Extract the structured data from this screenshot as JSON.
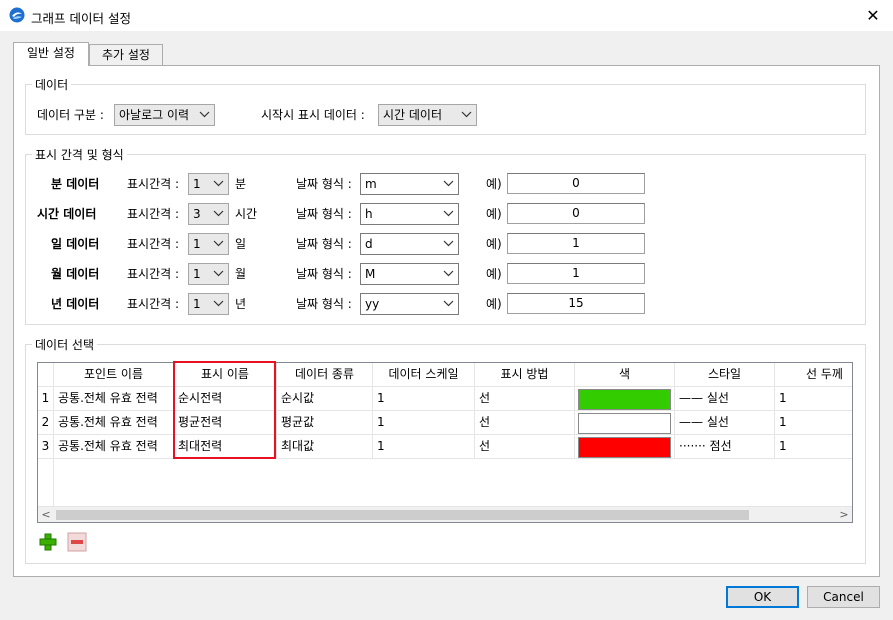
{
  "window": {
    "title": "그래프 데이터 설정",
    "close_glyph": "✕"
  },
  "tabs": [
    {
      "label": "일반 설정"
    },
    {
      "label": "추가 설정"
    }
  ],
  "data_group": {
    "title": "데이터",
    "type_label": "데이터 구분 :",
    "type_value": "아날로그 이력",
    "startup_label": "시작시 표시 데이터 :",
    "startup_value": "시간 데이터"
  },
  "interval_group": {
    "title": "표시 간격 및 형식",
    "interval_label": "표시간격 :",
    "date_format_label": "날짜 형식 :",
    "example_label": "예)",
    "rows": [
      {
        "name": "분 데이터",
        "interval": "1",
        "unit": "분",
        "format": "m",
        "example": "0"
      },
      {
        "name": "시간 데이터",
        "interval": "3",
        "unit": "시간",
        "format": "h",
        "example": "0"
      },
      {
        "name": "일 데이터",
        "interval": "1",
        "unit": "일",
        "format": "d",
        "example": "1"
      },
      {
        "name": "월 데이터",
        "interval": "1",
        "unit": "월",
        "format": "M",
        "example": "1"
      },
      {
        "name": "년 데이터",
        "interval": "1",
        "unit": "년",
        "format": "yy",
        "example": "15"
      }
    ]
  },
  "select_group": {
    "title": "데이터 선택",
    "columns": [
      "포인트 이름",
      "표시 이름",
      "데이터 종류",
      "데이터 스케일",
      "표시 방법",
      "색",
      "스타일",
      "선 두께"
    ],
    "rows": [
      {
        "num": "1",
        "point": "공통.전체 유효 전력",
        "display": "순시전력",
        "kind": "순시값",
        "scale": "1",
        "method": "선",
        "color": "#33cc00",
        "style_glyph": "——",
        "style": "실선",
        "width": "1"
      },
      {
        "num": "2",
        "point": "공통.전체 유효 전력",
        "display": "평균전력",
        "kind": "평균값",
        "scale": "1",
        "method": "선",
        "color": "#ffffff",
        "style_glyph": "——",
        "style": "실선",
        "width": "1"
      },
      {
        "num": "3",
        "point": "공통.전체 유효 전력",
        "display": "최대전력",
        "kind": "최대값",
        "scale": "1",
        "method": "선",
        "color": "#ff0000",
        "style_glyph": "·······",
        "style": "점선",
        "width": "1"
      }
    ],
    "scroll_left": "<",
    "scroll_right": ">"
  },
  "buttons": {
    "ok": "OK",
    "cancel": "Cancel"
  },
  "colors": {
    "highlight": "#e81123",
    "accent": "#0078d7"
  }
}
